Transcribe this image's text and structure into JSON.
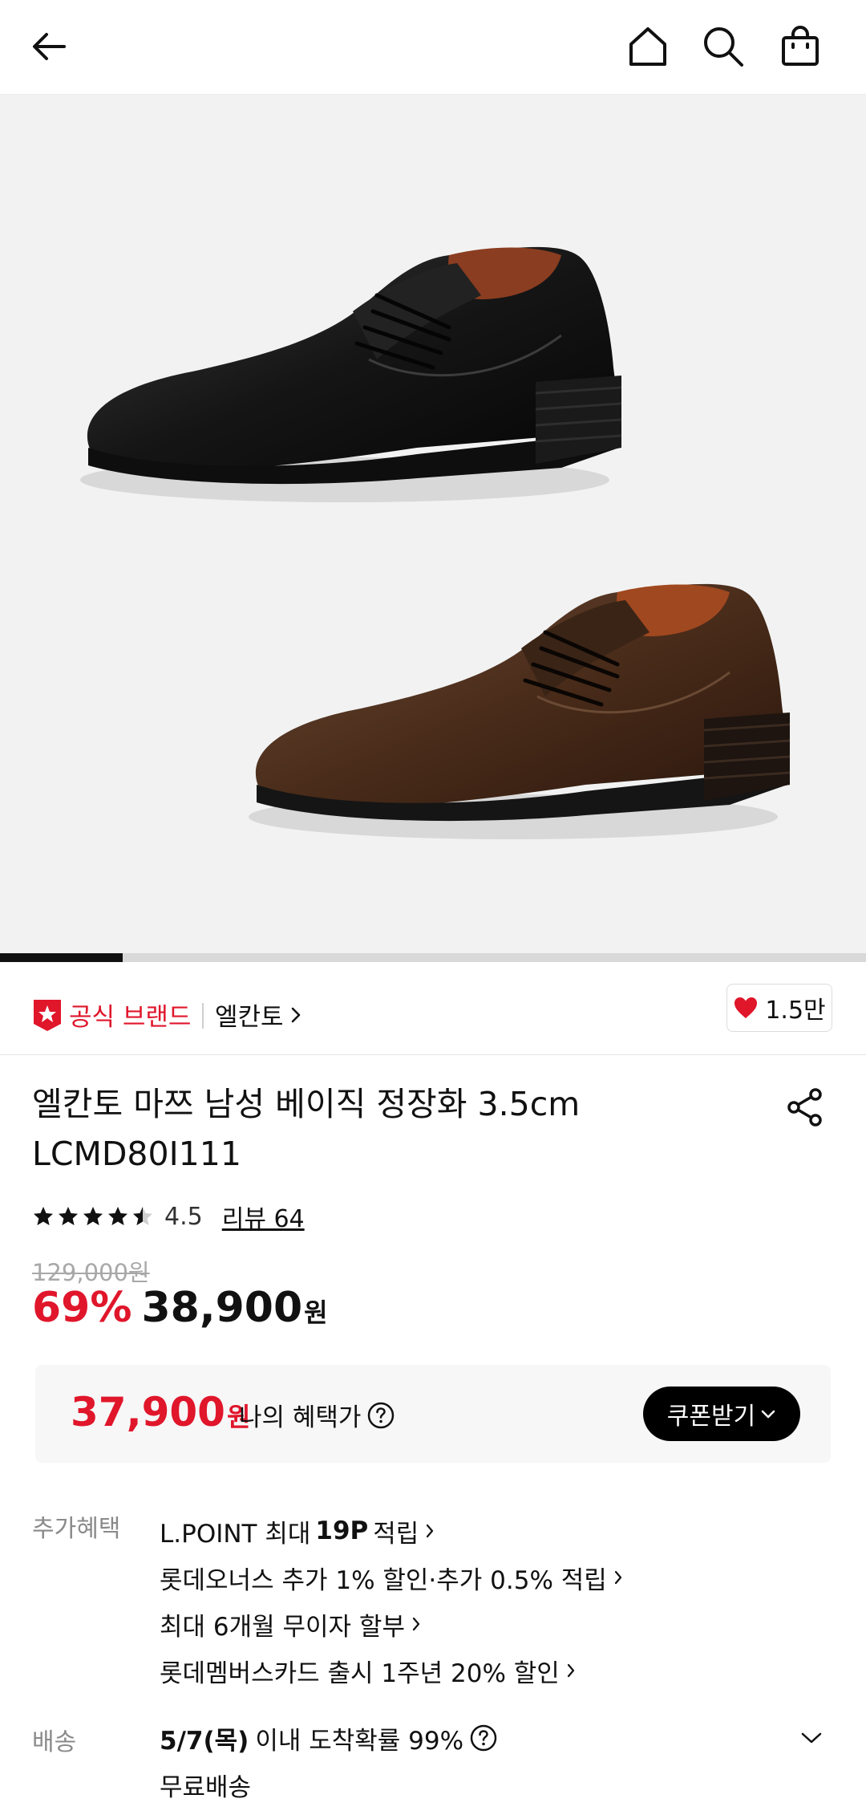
{
  "header": {
    "back_icon": "arrow-left-icon",
    "home_icon": "home-icon",
    "search_icon": "search-icon",
    "bag_icon": "shopping-bag-icon"
  },
  "gallery": {
    "progress_fraction": 0.142
  },
  "brand": {
    "official_label": "공식 브랜드",
    "name": "엘칸토",
    "likes": "1.5만",
    "accent_color": "#e0162b"
  },
  "product": {
    "title_line1": "엘칸토 마쯔 남성 베이직 정장화 3.5cm",
    "title_line2": "LCMD80I111",
    "rating": "4.5",
    "rating_value": 4.5,
    "review_label": "리뷰 64",
    "original_price": "129,000원",
    "discount": "69%",
    "price": "38,900",
    "price_unit": "원"
  },
  "benefit": {
    "price": "37,900",
    "unit": "원",
    "label": "나의 혜택가",
    "coupon_button": "쿠폰받기"
  },
  "extra": {
    "label": "추가혜택",
    "lpoint_prefix": "L.POINT 최대",
    "lpoint_points": "19P",
    "lpoint_suffix": "적립",
    "items": [
      "롯데오너스 추가 1% 할인·추가 0.5% 적립",
      "최대 6개월 무이자 할부",
      "롯데멤버스카드 출시 1주년 20% 할인"
    ]
  },
  "delivery": {
    "label": "배송",
    "date": "5/7(목)",
    "text": "이내 도착확률 99%",
    "free": "무료배송"
  }
}
